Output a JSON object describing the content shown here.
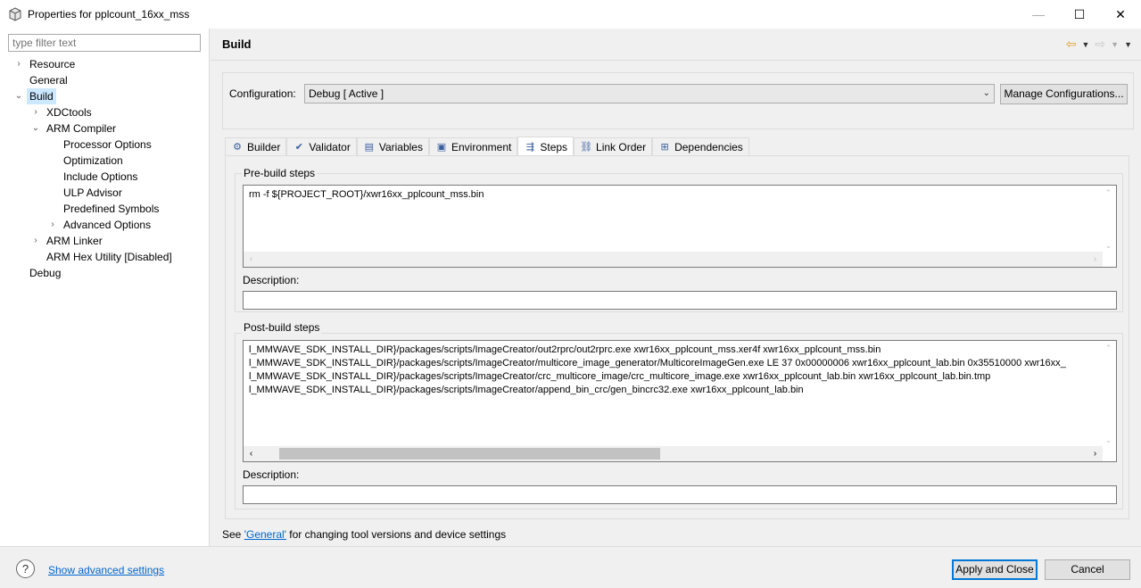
{
  "window": {
    "title": "Properties for pplcount_16xx_mss",
    "min_label": "—",
    "max_label": "☐",
    "close_label": "✕"
  },
  "filter": {
    "placeholder": "type filter text"
  },
  "tree": [
    {
      "label": "Resource",
      "depth": 0,
      "arrow": "›",
      "selected": false
    },
    {
      "label": "General",
      "depth": 0,
      "arrow": "",
      "selected": false
    },
    {
      "label": "Build",
      "depth": 0,
      "arrow": "⌄",
      "selected": true
    },
    {
      "label": "XDCtools",
      "depth": 1,
      "arrow": "›",
      "selected": false
    },
    {
      "label": "ARM Compiler",
      "depth": 1,
      "arrow": "⌄",
      "selected": false
    },
    {
      "label": "Processor Options",
      "depth": 2,
      "arrow": "",
      "selected": false
    },
    {
      "label": "Optimization",
      "depth": 2,
      "arrow": "",
      "selected": false
    },
    {
      "label": "Include Options",
      "depth": 2,
      "arrow": "",
      "selected": false
    },
    {
      "label": "ULP Advisor",
      "depth": 2,
      "arrow": "",
      "selected": false
    },
    {
      "label": "Predefined Symbols",
      "depth": 2,
      "arrow": "",
      "selected": false
    },
    {
      "label": "Advanced Options",
      "depth": 2,
      "arrow": "›",
      "selected": false
    },
    {
      "label": "ARM Linker",
      "depth": 1,
      "arrow": "›",
      "selected": false
    },
    {
      "label": "ARM Hex Utility  [Disabled]",
      "depth": 1,
      "arrow": "",
      "selected": false
    },
    {
      "label": "Debug",
      "depth": 0,
      "arrow": "",
      "selected": false
    }
  ],
  "header": {
    "title": "Build"
  },
  "config": {
    "label": "Configuration:",
    "value": "Debug  [ Active ]",
    "manage_label": "Manage Configurations..."
  },
  "tabs": [
    {
      "label": "Builder",
      "icon": "builder-icon",
      "active": false
    },
    {
      "label": "Validator",
      "icon": "validator-icon",
      "active": false
    },
    {
      "label": "Variables",
      "icon": "variables-icon",
      "active": false
    },
    {
      "label": "Environment",
      "icon": "environment-icon",
      "active": false
    },
    {
      "label": "Steps",
      "icon": "steps-icon",
      "active": true
    },
    {
      "label": "Link Order",
      "icon": "link-order-icon",
      "active": false
    },
    {
      "label": "Dependencies",
      "icon": "dependencies-icon",
      "active": false
    }
  ],
  "prebuild": {
    "title": "Pre-build steps",
    "lines": [
      "rm -f ${PROJECT_ROOT}/xwr16xx_pplcount_mss.bin"
    ],
    "desc_label": "Description:"
  },
  "postbuild": {
    "title": "Post-build steps",
    "lines": [
      "l_MMWAVE_SDK_INSTALL_DIR}/packages/scripts/ImageCreator/out2rprc/out2rprc.exe xwr16xx_pplcount_mss.xer4f xwr16xx_pplcount_mss.bin",
      "l_MMWAVE_SDK_INSTALL_DIR}/packages/scripts/ImageCreator/multicore_image_generator/MulticoreImageGen.exe LE 37 0x00000006 xwr16xx_pplcount_lab.bin 0x35510000 xwr16xx_",
      "l_MMWAVE_SDK_INSTALL_DIR}/packages/scripts/ImageCreator/crc_multicore_image/crc_multicore_image.exe xwr16xx_pplcount_lab.bin xwr16xx_pplcount_lab.bin.tmp",
      "l_MMWAVE_SDK_INSTALL_DIR}/packages/scripts/ImageCreator/append_bin_crc/gen_bincrc32.exe xwr16xx_pplcount_lab.bin"
    ],
    "desc_label": "Description:"
  },
  "see": {
    "prefix": "See ",
    "link": "'General'",
    "suffix": " for changing tool versions and device settings"
  },
  "bottom": {
    "help": "?",
    "advanced_link": "Show advanced settings",
    "apply_label": "Apply and Close",
    "cancel_label": "Cancel"
  }
}
